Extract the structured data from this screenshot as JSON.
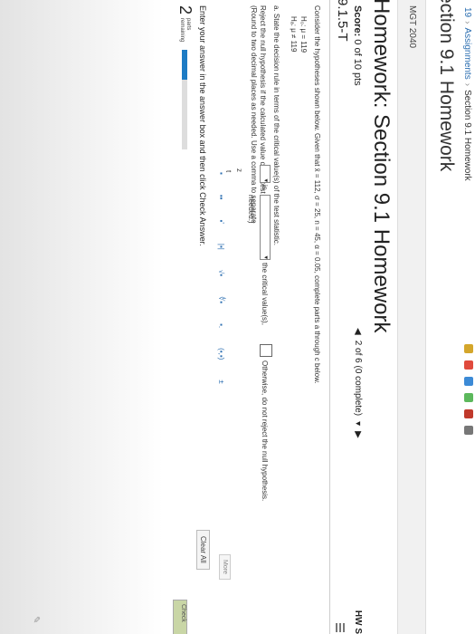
{
  "breadcrumb": {
    "item1": "19",
    "item2": "Assignments",
    "item3": "Section 9.1 Homework"
  },
  "section_title": "ection 9.1 Homework",
  "course": "MGT 2040",
  "homework_title": "Homework: Section 9.1 Homework",
  "score": {
    "label": "Score:",
    "value": "0 of 10 pts"
  },
  "question_id": "9.1.5-T",
  "nav": {
    "prev": "◀",
    "position": "2 of 6 (0 complete)",
    "dropdown": "▾",
    "next": "▶"
  },
  "hw_corner": "HW S",
  "question": {
    "intro": "Consider the hypotheses shown below. Given that x̄ = 112, σ = 25, n = 45, α = 0.05, complete parts a through c below.",
    "h0": "H₀: μ = 119",
    "ha": "Hₐ: μ ≠ 119",
    "part_a": "a. State the decision rule in terms of the critical value(s) of the test statistic.",
    "reject_prefix": "Reject the null hypothesis if the calculated value of the test statistic,",
    "is_label": "is",
    "critical_label": "the critical value(s),",
    "otherwise": "Otherwise, do not reject the null hypothesis.",
    "round_note": "(Round to two decimal places as needed. Use a comma to separate",
    "needed": "needed.)",
    "options": {
      "z": "z",
      "t": "t"
    }
  },
  "toolbar": [
    "▪",
    "▪▪",
    "▪'",
    "|▪|",
    "√▪",
    "∜▪",
    "▪.",
    "(▪,▪)",
    "±"
  ],
  "more_label": "More",
  "enter_instruction": "Enter your answer in the answer box and then click Check Answer.",
  "clear_label": "Clear All",
  "parts": {
    "count": "2",
    "label1": "parts",
    "label2": "remaining"
  },
  "progress": {
    "fraction": 0.3
  },
  "check_label": "Check",
  "colors": {
    "accent": "#1d7bc4",
    "link": "#2a6db0"
  }
}
